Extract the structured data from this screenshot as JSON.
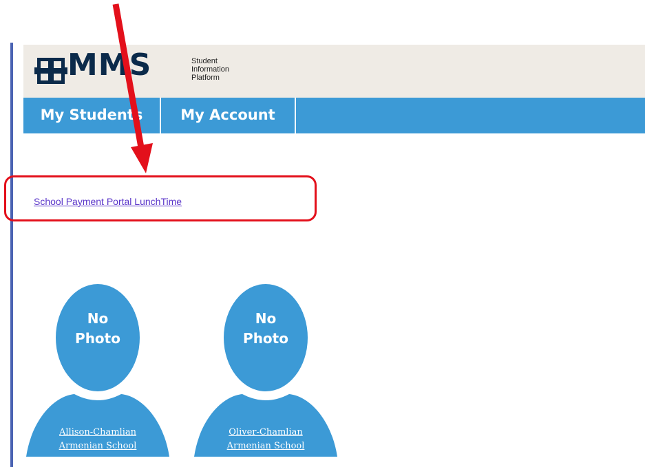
{
  "app": {
    "logo_text": "MMS",
    "logo_subtitle": "Student\nInformation\nPlatform"
  },
  "nav": {
    "tabs": [
      {
        "label": "My Students"
      },
      {
        "label": "My Account"
      }
    ]
  },
  "main": {
    "payment_link": "School Payment Portal LunchTime"
  },
  "students": [
    {
      "photo_placeholder": "No\nPhoto",
      "name": "Allison-Chamlian\nArmenian School"
    },
    {
      "photo_placeholder": "No\nPhoto",
      "name": "Oliver-Chamlian\nArmenian School"
    }
  ],
  "colors": {
    "nav_blue": "#3c9ad6",
    "header_bg": "#efebe5",
    "logo_navy": "#0b2a4a",
    "annotation_red": "#e3101b",
    "link_purple": "#5a35c9",
    "left_rule": "#4a63b3"
  },
  "icons": {
    "logo_mark": "mms-logo-icon",
    "avatar": "person-silhouette-icon",
    "annotation": "red-arrow-icon"
  }
}
